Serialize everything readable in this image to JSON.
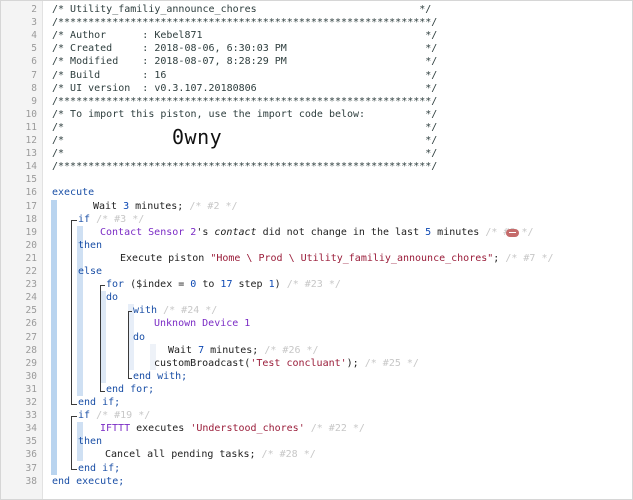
{
  "lines": [
    {
      "n": "2"
    },
    {
      "n": "3"
    },
    {
      "n": "4"
    },
    {
      "n": "5"
    },
    {
      "n": "6"
    },
    {
      "n": "7"
    },
    {
      "n": "8"
    },
    {
      "n": "9"
    },
    {
      "n": "10"
    },
    {
      "n": "11"
    },
    {
      "n": "12"
    },
    {
      "n": "13"
    },
    {
      "n": "14"
    },
    {
      "n": "15"
    },
    {
      "n": "16"
    },
    {
      "n": "17"
    },
    {
      "n": "18"
    },
    {
      "n": "19"
    },
    {
      "n": "20"
    },
    {
      "n": "21"
    },
    {
      "n": "22"
    },
    {
      "n": "23"
    },
    {
      "n": "24"
    },
    {
      "n": "25"
    },
    {
      "n": "26"
    },
    {
      "n": "27"
    },
    {
      "n": "28"
    },
    {
      "n": "29"
    },
    {
      "n": "30"
    },
    {
      "n": "31"
    },
    {
      "n": "32"
    },
    {
      "n": "33"
    },
    {
      "n": "34"
    },
    {
      "n": "35"
    },
    {
      "n": "36"
    },
    {
      "n": "37"
    },
    {
      "n": "38"
    }
  ],
  "header": {
    "title": "/* Utility_familiy_announce_chores                           */",
    "stars1": "/**************************************************************/",
    "author": "/* Author      : Kebel871                                     */",
    "created": "/* Created     : 2018-08-06, 6:30:03 PM                       */",
    "modified": "/* Modified    : 2018-08-07, 8:28:29 PM                       */",
    "build": "/* Build       : 16                                           */",
    "ui": "/* UI version  : v0.3.107.20180806                            */",
    "stars2": "/**************************************************************/",
    "import": "/* To import this piston, use the import code below:          */",
    "blank1": "/*                                                            */",
    "blank2": "/*                                                            */",
    "blank3": "/*                                                            */",
    "stars3": "/**************************************************************/",
    "import_code": "0wny"
  },
  "code": {
    "execute": "execute",
    "wait_kw": "Wait ",
    "wait_num": "3",
    "wait_unit": " minutes;",
    "wait_id": "/* #2 */",
    "if1_kw": "if",
    "if1_id": "/* #3 */",
    "cond_dev": "Contact Sensor 2",
    "cond_s": "'s ",
    "cond_attr": "contact",
    "cond_mid": " did not change in the last ",
    "cond_num": "5",
    "cond_unit": " minutes",
    "cond_id": "/* #8 */",
    "then1": "then",
    "exec_kw": "Execute piston ",
    "exec_str": "\"Home \\ Prod \\ Utility_familiy_announce_chores\"",
    "exec_end": ";",
    "exec_id": "/* #7 */",
    "else1": "else",
    "for_kw": "for",
    "for_mid1": " ($index = ",
    "for_a": "0",
    "for_to": " to ",
    "for_b": "17",
    "for_step": " step ",
    "for_c": "1",
    "for_end": ")",
    "for_id": "/* #23 */",
    "do1": "do",
    "with_kw": "with",
    "with_id": "/* #24 */",
    "unknown_dev": "Unknown Device 1",
    "do2": "do",
    "wait2_kw": "Wait ",
    "wait2_num": "7",
    "wait2_unit": " minutes;",
    "wait2_id": "/* #26 */",
    "bcast_kw": "customBroadcast(",
    "bcast_str": "'Test concluant'",
    "bcast_end": ");",
    "bcast_id": "/* #25 */",
    "endwith": "end with;",
    "endfor": "end for;",
    "endif1": "end if;",
    "if2_kw": "if",
    "if2_id": "/* #19 */",
    "ifttt": "IFTTT",
    "ifttt_mid": " executes ",
    "ifttt_str": "'Understood_chores'",
    "ifttt_id": "/* #22 */",
    "then2": "then",
    "cancel": "Cancel all pending tasks;",
    "cancel_id": "/* #28 */",
    "endif2": "end if;",
    "endexec": "end execute;"
  }
}
